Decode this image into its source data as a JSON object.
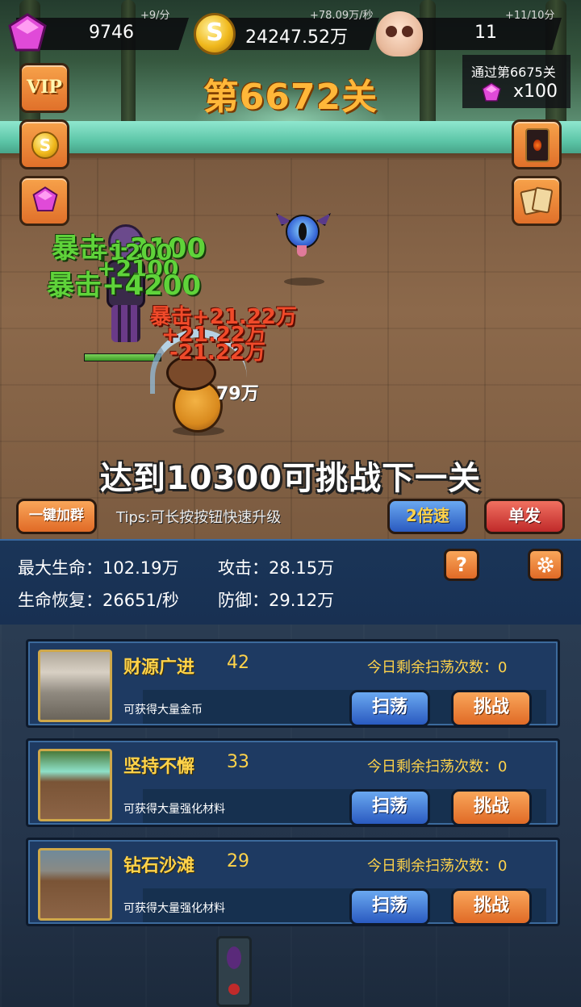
{
  "resources": {
    "gems": {
      "value": "9746",
      "rate": "+9/分",
      "icon": "gem-icon"
    },
    "coins": {
      "value": "24247.52万",
      "rate": "+78.09万/秒",
      "icon": "coin-icon"
    },
    "skulls": {
      "value": "11",
      "rate": "+11/10分",
      "icon": "skull-icon"
    }
  },
  "coin_glyph": "S",
  "level": {
    "title": "第6672关"
  },
  "pass_reward": {
    "label": "通过第6675关",
    "amount": "x100"
  },
  "side_buttons": {
    "vip_label": "VIP"
  },
  "damage_numbers": {
    "green": [
      "暴击+3100",
      "+1200",
      "+2100",
      "暴击+4200"
    ],
    "red": [
      "暴击+21.22万",
      "+21.22万",
      "-21.22万"
    ],
    "white": "79万"
  },
  "challenge_banner": "达到10300可挑战下一关",
  "controls": {
    "join_group": "一键加群",
    "tips": "Tips:可长按按钮快速升级",
    "speed": "2倍速",
    "single": "单发"
  },
  "stats": {
    "max_hp": "最大生命：102.19万",
    "attack": "攻击：28.15万",
    "regen": "生命恢复：26651/秒",
    "defense": "防御：29.12万",
    "help_label": "?",
    "settings_icon": "gear-icon"
  },
  "dungeons": [
    {
      "name": "财源广进",
      "level": "42",
      "sweeps": "今日剩余扫荡次数：0",
      "desc": "可获得大量金币",
      "sweep_label": "扫荡",
      "challenge_label": "挑战"
    },
    {
      "name": "坚持不懈",
      "level": "33",
      "sweeps": "今日剩余扫荡次数：0",
      "desc": "可获得大量强化材料",
      "sweep_label": "扫荡",
      "challenge_label": "挑战"
    },
    {
      "name": "钻石沙滩",
      "level": "29",
      "sweeps": "今日剩余扫荡次数：0",
      "desc": "可获得大量强化材料",
      "sweep_label": "扫荡",
      "challenge_label": "挑战"
    }
  ],
  "colors": {
    "accent_orange": "#e06a26",
    "accent_blue": "#2a5ac0",
    "gold_text": "#ffd34a",
    "panel": "#1e3a62"
  }
}
